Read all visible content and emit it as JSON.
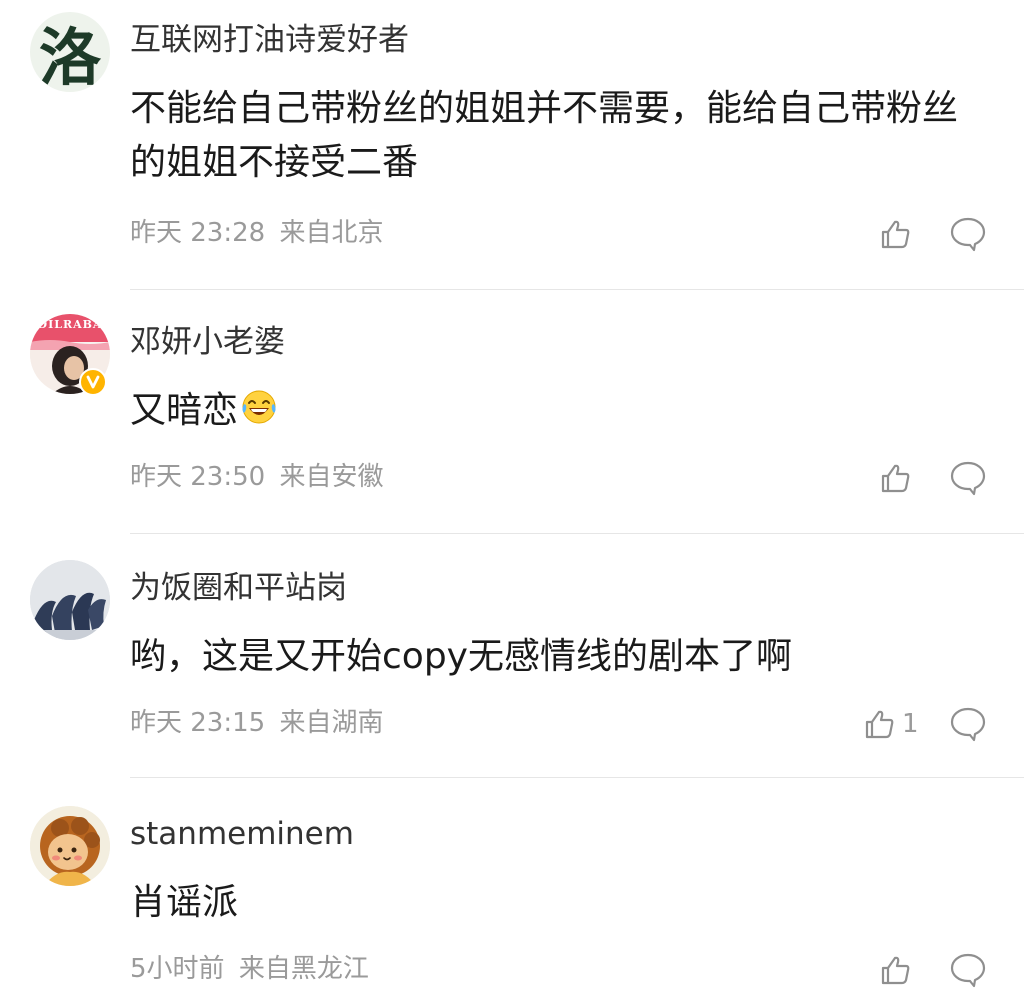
{
  "comments": [
    {
      "avatar_glyph": "洛",
      "username": "互联网打油诗爱好者",
      "content": "不能给自己带粉丝的姐姐并不需要，能给自己带粉丝的姐姐不接受二番",
      "time": "昨天 23:28",
      "location": "来自北京",
      "like_count": "",
      "avatar_icon": "calligraphy-character-avatar"
    },
    {
      "username": "邓妍小老婆",
      "content": "又暗恋",
      "time": "昨天 23:50",
      "location": "来自安徽",
      "like_count": "",
      "verified": true,
      "avatar_icon": "portrait-photo-avatar",
      "avatar_banner": "DILRABA",
      "emoji": "laughing-tears-emoji"
    },
    {
      "username": "为饭圈和平站岗",
      "content": "哟，这是又开始copy无感情线的剧本了啊",
      "time": "昨天 23:15",
      "location": "来自湖南",
      "like_count": "1",
      "avatar_icon": "silhouettes-avatar"
    },
    {
      "username": "stanmeminem",
      "content": "肖谣派",
      "time": "5小时前",
      "location": "来自黑龙江",
      "like_count": "",
      "avatar_icon": "cartoon-lion-avatar"
    }
  ],
  "icons": {
    "like": "thumbs-up-icon",
    "reply": "speech-bubble-icon"
  },
  "colors": {
    "meta_text": "#9a9a9a",
    "divider": "#e6e6e6",
    "verified_badge": "#ffb400"
  }
}
